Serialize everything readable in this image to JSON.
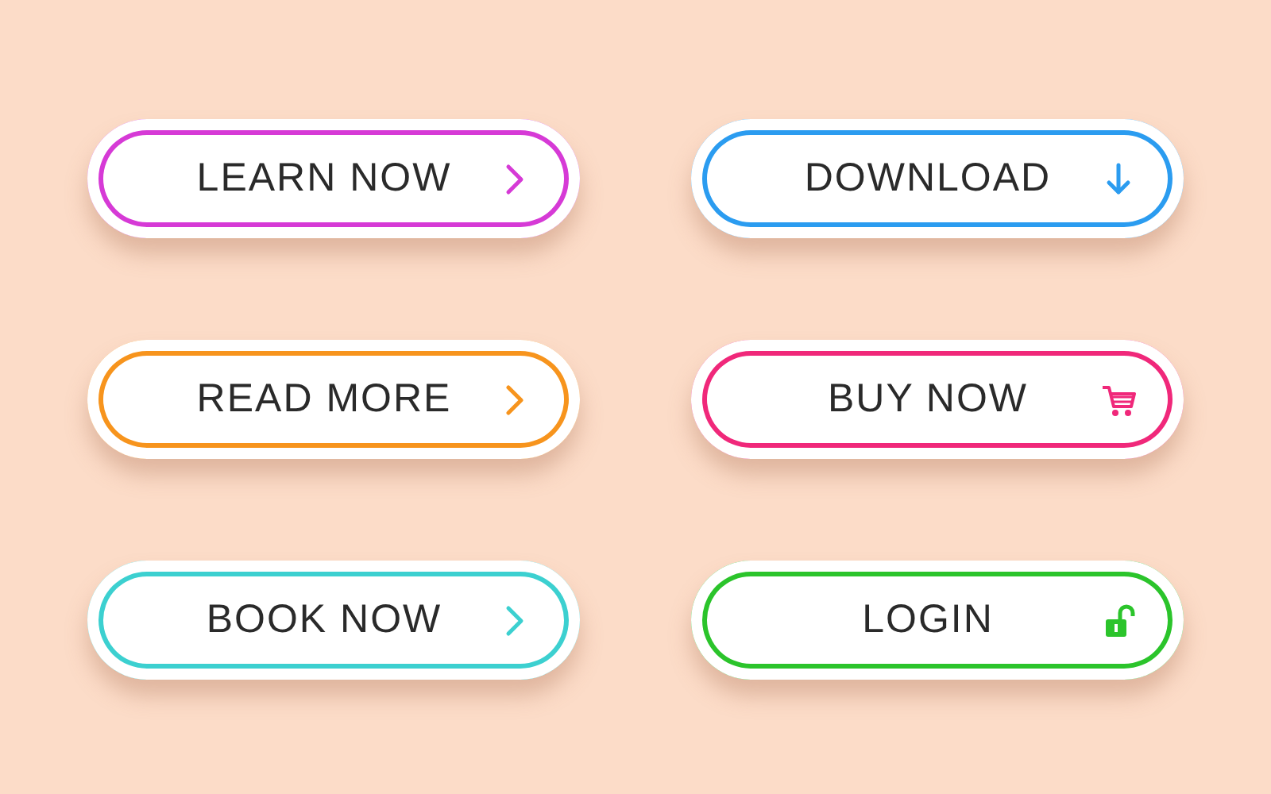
{
  "buttons": [
    {
      "label": "LEARN NOW",
      "color": "#d63ad6",
      "kind": "next"
    },
    {
      "label": "DOWNLOAD",
      "color": "#2b9cf0",
      "kind": "download"
    },
    {
      "label": "READ MORE",
      "color": "#f7941d",
      "kind": "next"
    },
    {
      "label": "BUY NOW",
      "color": "#f0287a",
      "kind": "cart"
    },
    {
      "label": "BOOK NOW",
      "color": "#3cd0d0",
      "kind": "next"
    },
    {
      "label": "LOGIN",
      "color": "#2bc42b",
      "kind": "login"
    }
  ]
}
